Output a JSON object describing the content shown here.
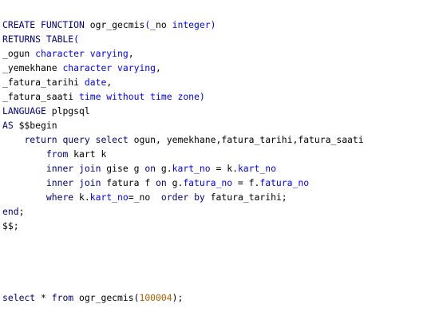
{
  "editor": {
    "lines": [
      [
        [
          "kw",
          "CREATE FUNCTION"
        ],
        [
          "id",
          " ogr_gecmis"
        ],
        [
          "type",
          "("
        ],
        [
          "id",
          "_no "
        ],
        [
          "type",
          "integer)"
        ]
      ],
      [
        [
          "kw",
          "RETURNS TABLE"
        ],
        [
          "type",
          "("
        ]
      ],
      [
        [
          "id",
          "_ogun "
        ],
        [
          "type",
          "character varying"
        ],
        [
          "id",
          ","
        ]
      ],
      [
        [
          "id",
          "_yemekhane "
        ],
        [
          "type",
          "character varying"
        ],
        [
          "id",
          ","
        ]
      ],
      [
        [
          "id",
          "_fatura_tarihi "
        ],
        [
          "type",
          "date"
        ],
        [
          "id",
          ","
        ]
      ],
      [
        [
          "id",
          "_fatura_saati "
        ],
        [
          "type",
          "time without time zone)"
        ]
      ],
      [
        [
          "kw",
          "LANGUAGE"
        ],
        [
          "id",
          " plpgsql"
        ]
      ],
      [
        [
          "kw",
          "AS"
        ],
        [
          "id",
          " $$begin"
        ]
      ],
      [
        [
          "id",
          "    "
        ],
        [
          "kw",
          "return query select"
        ],
        [
          "id",
          " ogun, yemekhane,fatura_tarihi,fatura_saati"
        ]
      ],
      [
        [
          "id",
          "        "
        ],
        [
          "kw",
          "from"
        ],
        [
          "id",
          " kart k"
        ]
      ],
      [
        [
          "id",
          "        "
        ],
        [
          "kw",
          "inner join"
        ],
        [
          "id",
          " gise g "
        ],
        [
          "kw",
          "on"
        ],
        [
          "id",
          " g."
        ],
        [
          "fld",
          "kart_no"
        ],
        [
          "id",
          " = k."
        ],
        [
          "fld",
          "kart_no"
        ]
      ],
      [
        [
          "id",
          "        "
        ],
        [
          "kw",
          "inner join"
        ],
        [
          "id",
          " fatura f "
        ],
        [
          "kw",
          "on"
        ],
        [
          "id",
          " g."
        ],
        [
          "fld",
          "fatura_no"
        ],
        [
          "id",
          " = f."
        ],
        [
          "fld",
          "fatura_no"
        ]
      ],
      [
        [
          "id",
          "        "
        ],
        [
          "kw",
          "where"
        ],
        [
          "id",
          " k."
        ],
        [
          "fld",
          "kart_no"
        ],
        [
          "id",
          "=_no  "
        ],
        [
          "kw",
          "order by"
        ],
        [
          "id",
          " fatura_tarihi;"
        ]
      ],
      [
        [
          "kw",
          "end"
        ],
        [
          "id",
          ";"
        ]
      ],
      [
        [
          "id",
          "$$;"
        ]
      ],
      [],
      [],
      [],
      [],
      [
        [
          "kw",
          "select"
        ],
        [
          "id",
          " * "
        ],
        [
          "kw",
          "from"
        ],
        [
          "id",
          " ogr_gecmis("
        ],
        [
          "num",
          "100004"
        ],
        [
          "id",
          ");"
        ]
      ]
    ]
  }
}
